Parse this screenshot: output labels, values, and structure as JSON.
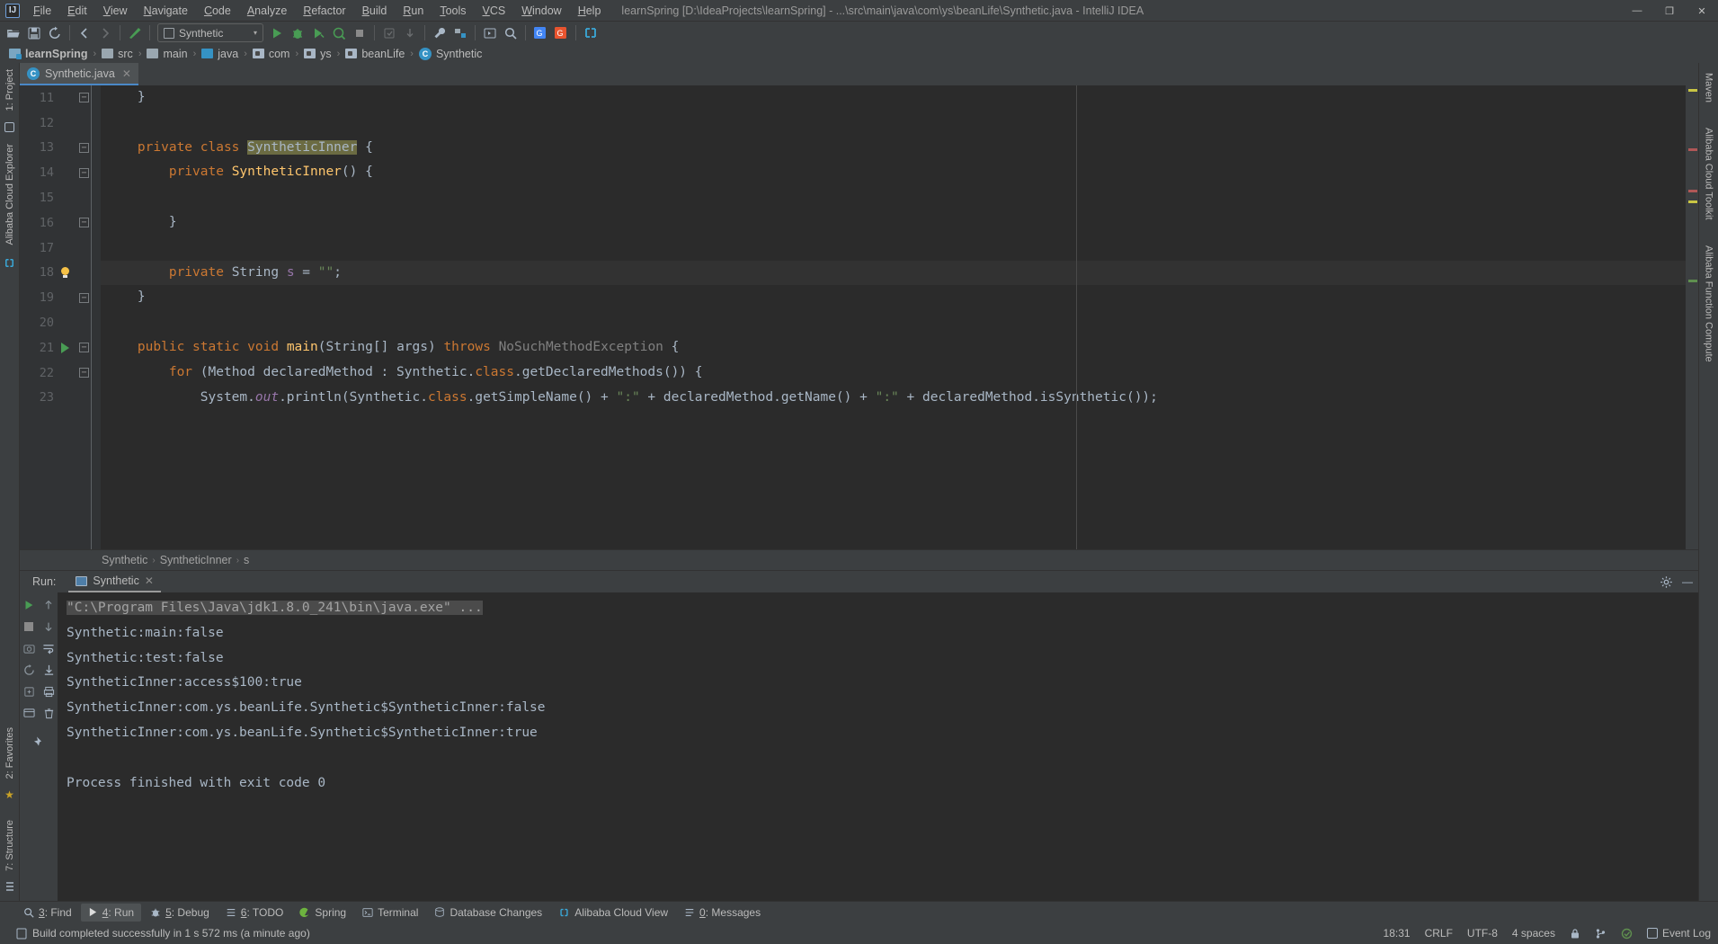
{
  "window": {
    "title": "learnSpring [D:\\IdeaProjects\\learnSpring] - ...\\src\\main\\java\\com\\ys\\beanLife\\Synthetic.java - IntelliJ IDEA",
    "logo": "IJ",
    "minimize": "—",
    "maximize": "❐",
    "close": "✕"
  },
  "menu": [
    {
      "label": "File"
    },
    {
      "label": "Edit"
    },
    {
      "label": "View"
    },
    {
      "label": "Navigate"
    },
    {
      "label": "Code"
    },
    {
      "label": "Analyze"
    },
    {
      "label": "Refactor"
    },
    {
      "label": "Build"
    },
    {
      "label": "Run"
    },
    {
      "label": "Tools"
    },
    {
      "label": "VCS"
    },
    {
      "label": "Window"
    },
    {
      "label": "Help"
    }
  ],
  "toolbar": {
    "run_config": "Synthetic",
    "caret": "▾",
    "icons": [
      "open-folder-icon",
      "save-all-icon",
      "sync-icon",
      "back-arrow-icon",
      "forward-arrow-icon",
      "update-project-icon",
      "run-icon",
      "debug-icon",
      "run-coverage-icon",
      "profile-icon",
      "stop-icon",
      "commit-icon",
      "update-icon",
      "build-icon",
      "project-structure-icon",
      "select-in-icon",
      "search-everywhere-icon",
      "google-translate-icon",
      "google-icon",
      "alibaba-cloud-icon"
    ]
  },
  "navbar": [
    {
      "label": "learnSpring",
      "icon": "module-icon",
      "bold": true
    },
    {
      "label": "src",
      "icon": "folder-icon",
      "bold": false
    },
    {
      "label": "main",
      "icon": "folder-icon",
      "bold": false
    },
    {
      "label": "java",
      "icon": "source-folder-icon",
      "bold": false
    },
    {
      "label": "com",
      "icon": "package-icon",
      "bold": false
    },
    {
      "label": "ys",
      "icon": "package-icon",
      "bold": false
    },
    {
      "label": "beanLife",
      "icon": "package-icon",
      "bold": false
    },
    {
      "label": "Synthetic",
      "icon": "java-class-icon",
      "bold": false
    }
  ],
  "left_strip": {
    "top": [
      {
        "label": "1: Project",
        "icon": "project-icon"
      },
      {
        "label": "Alibaba Cloud Explorer",
        "icon": "cloud-icon"
      }
    ],
    "bottom": [
      {
        "label": "2: Favorites",
        "icon": "star-icon"
      },
      {
        "label": "7: Structure",
        "icon": "structure-icon"
      }
    ]
  },
  "right_strip": {
    "items": [
      {
        "label": "Maven",
        "icon": "maven-icon"
      },
      {
        "label": "Alibaba Cloud Toolkit",
        "icon": "cloud-toolkit-icon"
      },
      {
        "label": "Alibaba Function Compute",
        "icon": "function-compute-icon"
      }
    ]
  },
  "editor": {
    "tab": {
      "label": "Synthetic.java",
      "icon": "java-class-icon",
      "close": "✕"
    },
    "lines": [
      {
        "num": 11,
        "fold": "collapse",
        "marker": "",
        "tokens": [
          {
            "t": "    ",
            "c": "pl"
          },
          {
            "t": "}",
            "c": "pl"
          }
        ]
      },
      {
        "num": 12,
        "fold": "",
        "marker": "",
        "tokens": []
      },
      {
        "num": 13,
        "fold": "collapse",
        "marker": "",
        "tokens": [
          {
            "t": "    ",
            "c": "pl"
          },
          {
            "t": "private",
            "c": "kw"
          },
          {
            "t": " ",
            "c": "pl"
          },
          {
            "t": "class",
            "c": "kw"
          },
          {
            "t": " ",
            "c": "pl"
          },
          {
            "t": "SyntheticInner",
            "c": "sel"
          },
          {
            "t": " {",
            "c": "pl"
          }
        ]
      },
      {
        "num": 14,
        "fold": "collapse",
        "marker": "",
        "tokens": [
          {
            "t": "        ",
            "c": "pl"
          },
          {
            "t": "private",
            "c": "kw"
          },
          {
            "t": " ",
            "c": "pl"
          },
          {
            "t": "SyntheticInner",
            "c": "fn"
          },
          {
            "t": "() {",
            "c": "pl"
          }
        ]
      },
      {
        "num": 15,
        "fold": "",
        "marker": "",
        "tokens": []
      },
      {
        "num": 16,
        "fold": "collapse",
        "marker": "",
        "tokens": [
          {
            "t": "        }",
            "c": "pl"
          }
        ]
      },
      {
        "num": 17,
        "fold": "",
        "marker": "",
        "tokens": []
      },
      {
        "num": 18,
        "fold": "",
        "marker": "bulb",
        "highlight": true,
        "tokens": [
          {
            "t": "        ",
            "c": "pl"
          },
          {
            "t": "private",
            "c": "kw"
          },
          {
            "t": " ",
            "c": "pl"
          },
          {
            "t": "String",
            "c": "typ"
          },
          {
            "t": " ",
            "c": "pl"
          },
          {
            "t": "s",
            "c": "fld"
          },
          {
            "t": " = ",
            "c": "pl"
          },
          {
            "t": "\"\"",
            "c": "str"
          },
          {
            "t": ";",
            "c": "pl"
          }
        ]
      },
      {
        "num": 19,
        "fold": "collapse",
        "marker": "",
        "tokens": [
          {
            "t": "    }",
            "c": "pl"
          }
        ]
      },
      {
        "num": 20,
        "fold": "",
        "marker": "",
        "tokens": []
      },
      {
        "num": 21,
        "fold": "collapse",
        "marker": "run",
        "tokens": [
          {
            "t": "    ",
            "c": "pl"
          },
          {
            "t": "public",
            "c": "kw"
          },
          {
            "t": " ",
            "c": "pl"
          },
          {
            "t": "static",
            "c": "kw"
          },
          {
            "t": " ",
            "c": "pl"
          },
          {
            "t": "void",
            "c": "kw"
          },
          {
            "t": " ",
            "c": "pl"
          },
          {
            "t": "main",
            "c": "fn"
          },
          {
            "t": "(",
            "c": "pl"
          },
          {
            "t": "String",
            "c": "typ"
          },
          {
            "t": "[] args) ",
            "c": "pl"
          },
          {
            "t": "throws",
            "c": "kw"
          },
          {
            "t": " ",
            "c": "pl"
          },
          {
            "t": "NoSuchMethodException",
            "c": "grey"
          },
          {
            "t": " {",
            "c": "pl"
          }
        ]
      },
      {
        "num": 22,
        "fold": "collapse",
        "marker": "",
        "tokens": [
          {
            "t": "        ",
            "c": "pl"
          },
          {
            "t": "for",
            "c": "kw"
          },
          {
            "t": " (Method declaredMethod : Synthetic.",
            "c": "pl"
          },
          {
            "t": "class",
            "c": "kw"
          },
          {
            "t": ".getDeclaredMethods()) {",
            "c": "pl"
          }
        ]
      },
      {
        "num": 23,
        "fold": "",
        "marker": "",
        "tokens": [
          {
            "t": "            System.",
            "c": "pl"
          },
          {
            "t": "out",
            "c": "fldi"
          },
          {
            "t": ".println(Synthetic.",
            "c": "pl"
          },
          {
            "t": "class",
            "c": "kw"
          },
          {
            "t": ".getSimpleName() + ",
            "c": "pl"
          },
          {
            "t": "\":\"",
            "c": "str"
          },
          {
            "t": " + declaredMethod.getName() + ",
            "c": "pl"
          },
          {
            "t": "\":\"",
            "c": "str"
          },
          {
            "t": " + declaredMethod.isSynthetic());",
            "c": "pl"
          }
        ]
      }
    ],
    "breadcrumbs": [
      {
        "label": "Synthetic"
      },
      {
        "label": "SyntheticInner"
      },
      {
        "label": "s"
      }
    ],
    "breadcrumb_sep": "›"
  },
  "run_panel": {
    "label": "Run:",
    "tab": {
      "label": "Synthetic",
      "close": "✕",
      "icon": "run-config-icon"
    },
    "header_icons": [
      "settings-gear-icon",
      "hide-icon"
    ],
    "minimize": "—",
    "left_tools": [
      "rerun-icon",
      "stop-icon",
      "capture-dump-icon",
      "soft-wrap-icon",
      "print-icon",
      "scroll-to-end-icon",
      "pin-icon"
    ],
    "left_tools2": [
      "up-arrow-icon",
      "down-arrow-icon",
      "wrap-icon",
      "scroll-down-icon",
      "print-icon",
      "trash-icon"
    ],
    "console": [
      {
        "text": "\"C:\\Program Files\\Java\\jdk1.8.0_241\\bin\\java.exe\" ...",
        "kind": "command"
      },
      {
        "text": "Synthetic:main:false",
        "kind": "out"
      },
      {
        "text": "Synthetic:test:false",
        "kind": "out"
      },
      {
        "text": "SyntheticInner:access$100:true",
        "kind": "out"
      },
      {
        "text": "SyntheticInner:com.ys.beanLife.Synthetic$SyntheticInner:false",
        "kind": "out"
      },
      {
        "text": "SyntheticInner:com.ys.beanLife.Synthetic$SyntheticInner:true",
        "kind": "out"
      },
      {
        "text": "",
        "kind": "out"
      },
      {
        "text": "Process finished with exit code 0",
        "kind": "out"
      }
    ]
  },
  "bottom_tabs": [
    {
      "label": "3: Find",
      "icon": "search-icon",
      "active": false
    },
    {
      "label": "4: Run",
      "icon": "run-icon",
      "active": true
    },
    {
      "label": "5: Debug",
      "icon": "debug-icon",
      "active": false
    },
    {
      "label": "6: TODO",
      "icon": "todo-icon",
      "active": false
    },
    {
      "label": "Spring",
      "icon": "spring-icon",
      "active": false
    },
    {
      "label": "Terminal",
      "icon": "terminal-icon",
      "active": false
    },
    {
      "label": "Database Changes",
      "icon": "database-icon",
      "active": false
    },
    {
      "label": "Alibaba Cloud View",
      "icon": "alibaba-cloud-icon",
      "active": false
    },
    {
      "label": "0: Messages",
      "icon": "messages-icon",
      "active": false
    }
  ],
  "statusbar": {
    "message": "Build completed successfully in 1 s 572 ms (a minute ago)",
    "time": "18:31",
    "line_sep": "CRLF",
    "encoding": "UTF-8",
    "indent": "4 spaces",
    "event_log": "Event Log",
    "icons": [
      "lock-icon",
      "branch-icon",
      "inspection-icon",
      "memory-icon"
    ]
  },
  "colors": {
    "accent": "#4a88c7",
    "bg_chrome": "#3c3f41",
    "bg_editor": "#2b2b2b",
    "keyword": "#cc7832",
    "string": "#6a8759",
    "method": "#ffc66d",
    "field": "#9876aa",
    "text": "#a9b7c6",
    "run_green": "#499c54"
  }
}
